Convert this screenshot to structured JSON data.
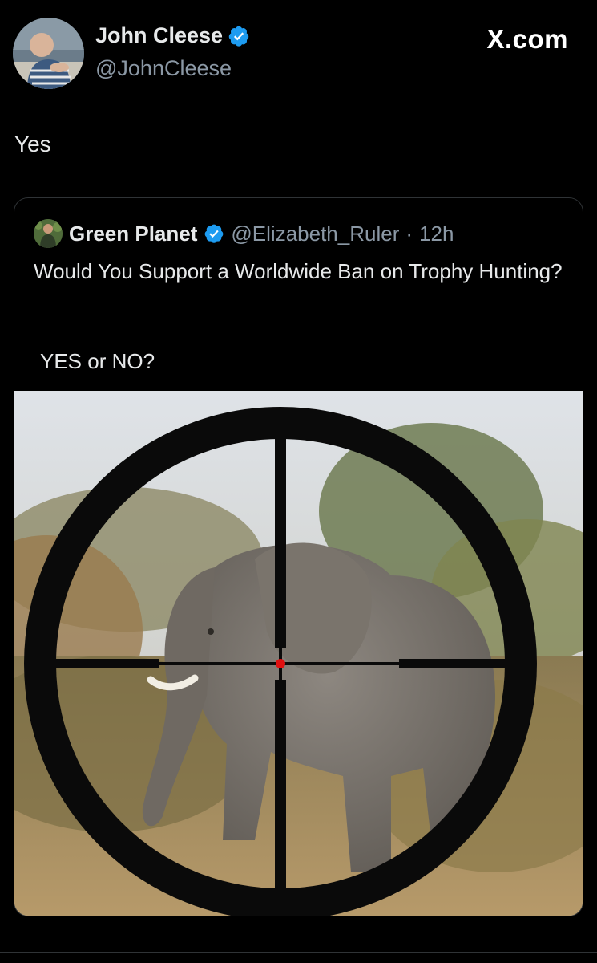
{
  "author": {
    "name": "John Cleese",
    "handle": "@JohnCleese",
    "avatar_icon": "profile-photo"
  },
  "brand": "X.com",
  "tweet": {
    "text": "Yes"
  },
  "quote": {
    "name": "Green Planet",
    "handle": "@Elizabeth_Ruler",
    "separator": "·",
    "time": "12h",
    "text": "Would You Support a Worldwide Ban on Trophy Hunting?",
    "text2": "YES or NO?",
    "image_icon": "elephant-in-rifle-scope-photo"
  },
  "colors": {
    "background": "#000000",
    "text_primary": "#e7e9ea",
    "text_secondary": "#8b98a5",
    "verified": "#1d9bf0",
    "border": "#2f3336"
  }
}
